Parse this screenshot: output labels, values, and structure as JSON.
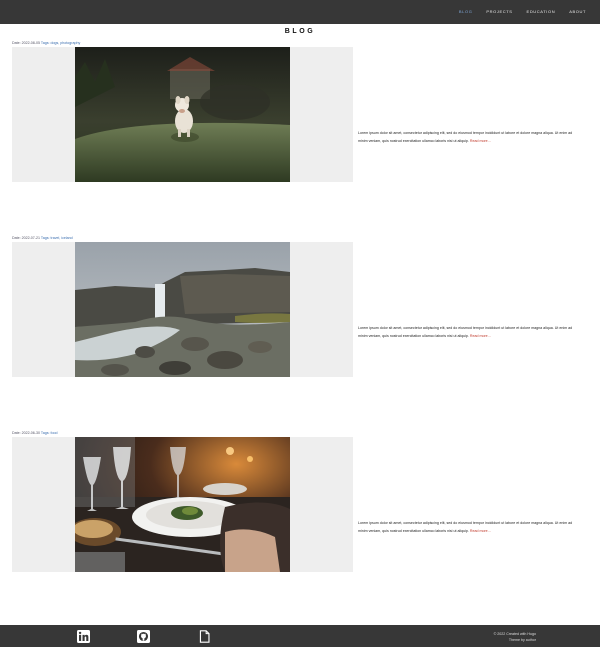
{
  "nav": {
    "items": [
      {
        "label": "Blog"
      },
      {
        "label": "Projects"
      },
      {
        "label": "Education"
      },
      {
        "label": "About"
      }
    ]
  },
  "page": {
    "title": "BLOG"
  },
  "posts": [
    {
      "date": "Date: 2022-08-05",
      "tags": "Tags: dogs, photography",
      "excerpt": "Lorem ipsum dolor sit amet, consectetur adipiscing elit, sed do eiusmod tempor incididunt ut labore et dolore magna aliqua. Ut enim ad minim veniam, quis nostrud exercitation ullamco laboris nisi ut aliquip.",
      "more": "Read more…",
      "image": "dog-on-grass-photo"
    },
    {
      "date": "Date: 2022-07-21",
      "tags": "Tags: travel, iceland",
      "excerpt": "Lorem ipsum dolor sit amet, consectetur adipiscing elit, sed do eiusmod tempor incididunt ut labore et dolore magna aliqua. Ut enim ad minim veniam, quis nostrud exercitation ullamco laboris nisi ut aliquip.",
      "more": "Read more…",
      "image": "waterfall-photo"
    },
    {
      "date": "Date: 2022-06-30",
      "tags": "Tags: food",
      "excerpt": "Lorem ipsum dolor sit amet, consectetur adipiscing elit, sed do eiusmod tempor incididunt ut labore et dolore magna aliqua. Ut enim ad minim veniam, quis nostrud exercitation ullamco laboris nisi ut aliquip.",
      "more": "Read more…",
      "image": "dinner-plate-photo"
    }
  ],
  "footer": {
    "icons": [
      "linkedin-icon",
      "github-icon",
      "document-icon"
    ],
    "line1": "© 2022 Created with Hugo",
    "line2": "Theme by author"
  },
  "colors": {
    "bar": "#373737",
    "media_bg": "#eeeeee",
    "nav_active": "#7fa6d6",
    "link_red": "#c0392b"
  }
}
